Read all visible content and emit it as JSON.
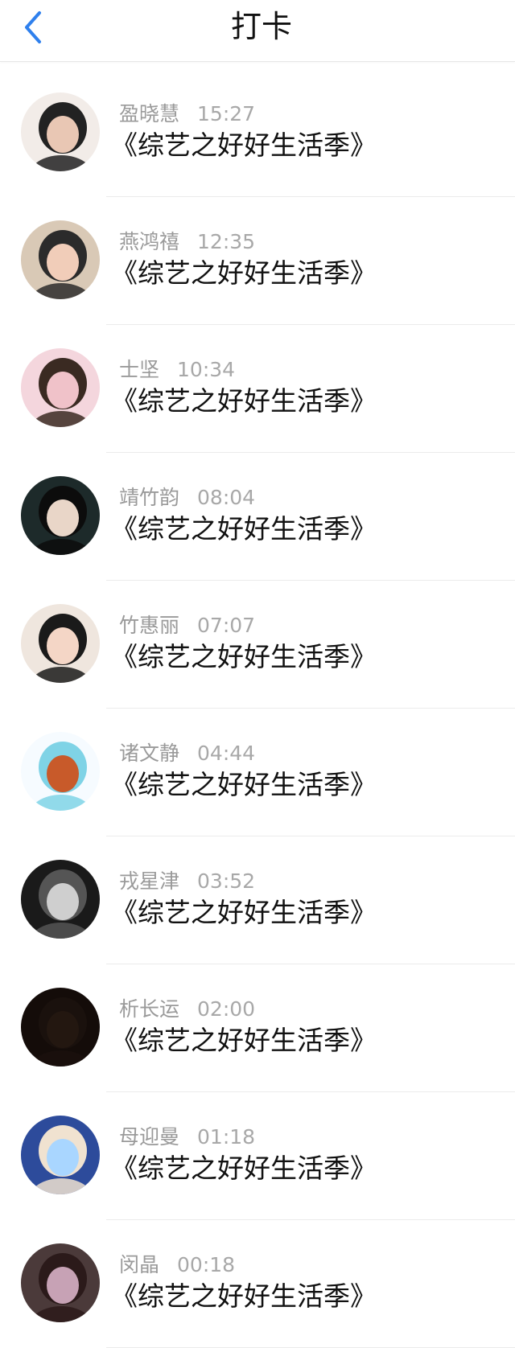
{
  "header": {
    "title": "打卡",
    "back_icon": "chevron-left-icon",
    "accent_color": "#2f80ed"
  },
  "entries": [
    {
      "name": "盈晓慧",
      "time": "15:27",
      "book": "《综艺之好好生活季》",
      "avatar_colors": [
        "#f2ece8",
        "#222222",
        "#e9c7b4"
      ]
    },
    {
      "name": "燕鸿禧",
      "time": "12:35",
      "book": "《综艺之好好生活季》",
      "avatar_colors": [
        "#d9c9b6",
        "#2b2b2b",
        "#f1cdb9"
      ]
    },
    {
      "name": "士坚",
      "time": "10:34",
      "book": "《综艺之好好生活季》",
      "avatar_colors": [
        "#f4d6dd",
        "#3a2a22",
        "#f0c2c9"
      ]
    },
    {
      "name": "靖竹韵",
      "time": "08:04",
      "book": "《综艺之好好生活季》",
      "avatar_colors": [
        "#1d2a2a",
        "#0c0c0c",
        "#e9d6c8"
      ]
    },
    {
      "name": "竹惠丽",
      "time": "07:07",
      "book": "《综艺之好好生活季》",
      "avatar_colors": [
        "#efe6de",
        "#1a1a1a",
        "#f4d6c6"
      ]
    },
    {
      "name": "诸文静",
      "time": "04:44",
      "book": "《综艺之好好生活季》",
      "avatar_colors": [
        "#f6fbff",
        "#7fd3e6",
        "#c85a2a"
      ]
    },
    {
      "name": "戎星津",
      "time": "03:52",
      "book": "《综艺之好好生活季》",
      "avatar_colors": [
        "#1a1a1a",
        "#555555",
        "#cfcfcf"
      ]
    },
    {
      "name": "析长运",
      "time": "02:00",
      "book": "《综艺之好好生活季》",
      "avatar_colors": [
        "#140c09",
        "#1a110d",
        "#231710"
      ]
    },
    {
      "name": "母迎曼",
      "time": "01:18",
      "book": "《综艺之好好生活季》",
      "avatar_colors": [
        "#2d4b9b",
        "#f0e2d0",
        "#a9d6ff"
      ]
    },
    {
      "name": "闵晶",
      "time": "00:18",
      "book": "《综艺之好好生活季》",
      "avatar_colors": [
        "#4b3a3a",
        "#2b1a1a",
        "#c7a2b5"
      ]
    }
  ]
}
